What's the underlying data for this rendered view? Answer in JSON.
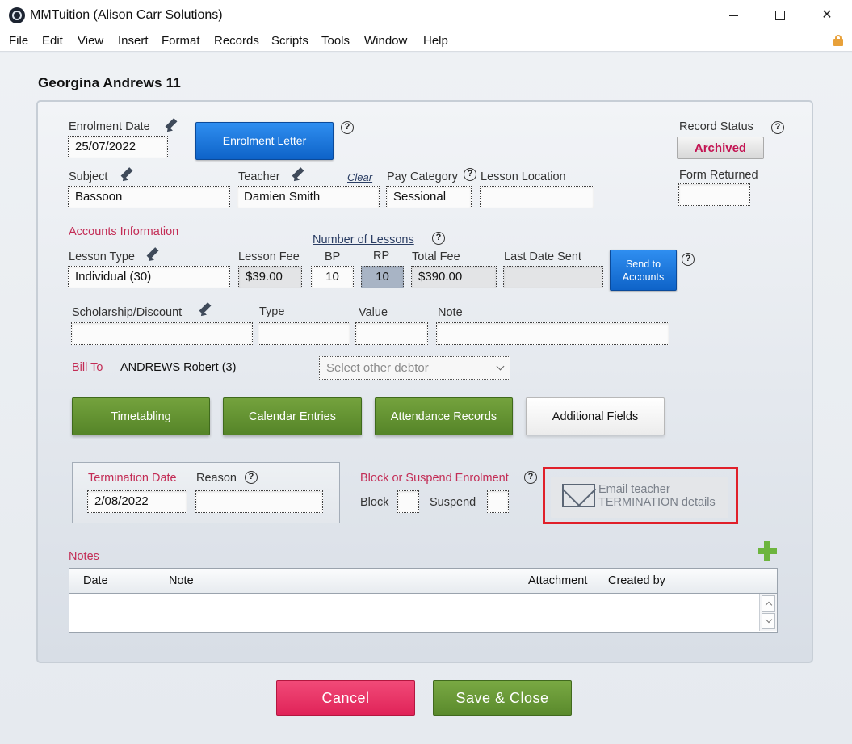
{
  "window": {
    "title": "MMTuition (Alison Carr Solutions)"
  },
  "menu": [
    "File",
    "Edit",
    "View",
    "Insert",
    "Format",
    "Records",
    "Scripts",
    "Tools",
    "Window",
    "Help"
  ],
  "record": {
    "title": "Georgina Andrews 11"
  },
  "enrolment": {
    "date_label": "Enrolment Date",
    "date_value": "25/07/2022",
    "letter_button": "Enrolment Letter"
  },
  "record_status": {
    "label": "Record Status",
    "value": "Archived"
  },
  "form_returned": {
    "label": "Form Returned",
    "value": ""
  },
  "subject": {
    "label": "Subject",
    "value": "Bassoon"
  },
  "teacher": {
    "label": "Teacher",
    "clear_link": "Clear",
    "value": "Damien Smith"
  },
  "pay_category": {
    "label": "Pay Category",
    "value": "Sessional"
  },
  "lesson_location": {
    "label": "Lesson Location",
    "value": ""
  },
  "accounts": {
    "section_label": "Accounts Information",
    "number_of_lessons_label": "Number of Lessons",
    "lesson_type_label": "Lesson Type",
    "lesson_type_value": "Individual (30)",
    "lesson_fee_label": "Lesson Fee",
    "lesson_fee_value": "$39.00",
    "bp_label": "BP",
    "bp_value": "10",
    "rp_label": "RP",
    "rp_value": "10",
    "total_fee_label": "Total Fee",
    "total_fee_value": "$390.00",
    "last_date_sent_label": "Last Date Sent",
    "last_date_sent_value": "",
    "send_button_line1": "Send to",
    "send_button_line2": "Accounts"
  },
  "scholarship": {
    "label": "Scholarship/Discount",
    "value": "",
    "type_label": "Type",
    "type_value": "",
    "value_label": "Value",
    "value_value": "",
    "note_label": "Note",
    "note_value": ""
  },
  "bill_to": {
    "label": "Bill To",
    "value": "ANDREWS Robert (3)",
    "select_placeholder": "Select other debtor"
  },
  "action_buttons": {
    "timetabling": "Timetabling",
    "calendar_entries": "Calendar Entries",
    "attendance_records": "Attendance Records",
    "additional_fields": "Additional Fields"
  },
  "termination": {
    "date_label": "Termination Date",
    "date_value": "2/08/2022",
    "reason_label": "Reason",
    "reason_value": ""
  },
  "block_suspend": {
    "label": "Block or Suspend Enrolment",
    "block_label": "Block",
    "suspend_label": "Suspend"
  },
  "email_teacher": {
    "line1": "Email teacher",
    "line2": "TERMINATION details"
  },
  "notes": {
    "label": "Notes",
    "columns": [
      "Date",
      "Note",
      "Attachment",
      "Created by"
    ]
  },
  "footer": {
    "cancel": "Cancel",
    "save_close": "Save & Close"
  },
  "colors": {
    "accent_red": "#c32c55",
    "status_archived": "#c31452",
    "primary_blue": "#0e63c8",
    "action_green": "#558428",
    "highlight_red": "#e0202a"
  }
}
